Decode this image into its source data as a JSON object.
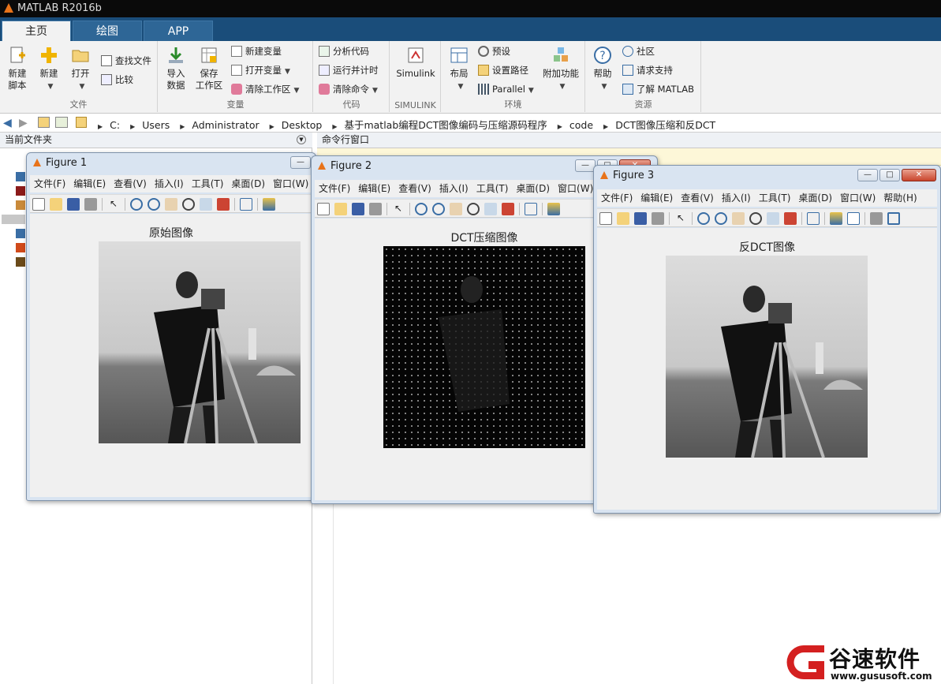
{
  "app": {
    "title": "MATLAB R2016b"
  },
  "tabs": [
    {
      "label": "主页"
    },
    {
      "label": "绘图"
    },
    {
      "label": "APP"
    }
  ],
  "ribbon": {
    "file": {
      "label": "文件",
      "new_script": "新建\n脚本",
      "new": "新建",
      "open": "打开",
      "find_files": "查找文件",
      "compare": "比较"
    },
    "variable": {
      "label": "变量",
      "import": "导入\n数据",
      "save_ws": "保存\n工作区",
      "new_var": "新建变量",
      "open_var": "打开变量",
      "clear_ws": "清除工作区"
    },
    "code": {
      "label": "代码",
      "analyze": "分析代码",
      "run_time": "运行并计时",
      "clear_cmd": "清除命令"
    },
    "simulink": {
      "label": "SIMULINK",
      "button": "Simulink"
    },
    "env": {
      "label": "环境",
      "layout": "布局",
      "prefs": "预设",
      "set_path": "设置路径",
      "parallel": "Parallel",
      "addons": "附加功能"
    },
    "resources": {
      "label": "资源",
      "help": "帮助",
      "community": "社区",
      "support": "请求支持",
      "learn": "了解 MATLAB"
    }
  },
  "address": {
    "crumbs": [
      "C:",
      "Users",
      "Administrator",
      "Desktop",
      "基于matlab编程DCT图像编码与压缩源码程序",
      "code",
      "DCT图像压缩和反DCT"
    ]
  },
  "panels": {
    "current_folder": "当前文件夹",
    "command_window": "命令行窗口"
  },
  "figures": [
    {
      "title": "Figure 1",
      "plot_title": "原始图像",
      "menu": [
        "文件(F)",
        "编辑(E)",
        "查看(V)",
        "插入(I)",
        "工具(T)",
        "桌面(D)",
        "窗口(W)"
      ]
    },
    {
      "title": "Figure 2",
      "plot_title": "DCT压缩图像",
      "menu": [
        "文件(F)",
        "编辑(E)",
        "查看(V)",
        "插入(I)",
        "工具(T)",
        "桌面(D)",
        "窗口(W)"
      ]
    },
    {
      "title": "Figure 3",
      "plot_title": "反DCT图像",
      "menu": [
        "文件(F)",
        "编辑(E)",
        "查看(V)",
        "插入(I)",
        "工具(T)",
        "桌面(D)",
        "窗口(W)",
        "帮助(H)"
      ]
    }
  ],
  "watermark": {
    "name": "谷速软件",
    "url": "www.gususoft.com"
  },
  "colors": {
    "tab_bar": "#1a4d7a",
    "ribbon_bg": "#f2f2f2",
    "figure_frame": "#d9e4f1",
    "figure_bg": "#f0f0f0",
    "logo_red": "#d42020"
  }
}
